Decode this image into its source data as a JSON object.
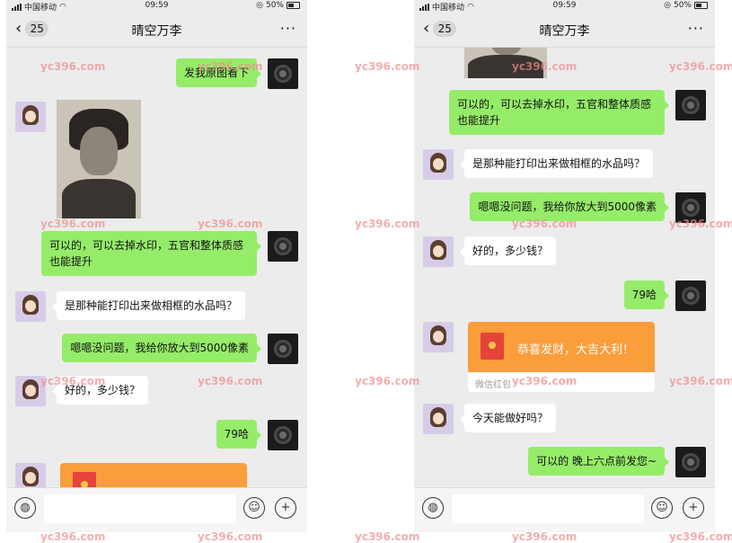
{
  "status": {
    "carrier": "中国移动",
    "time": "09:59",
    "battery": "50%"
  },
  "nav": {
    "back_count": "25",
    "title": "晴空万李",
    "more": "···"
  },
  "watermark": "yc396.com",
  "left_chat": {
    "msg1": "发我原图看下",
    "msg2": "可以的，可以去掉水印，五官和整体质感也能提升",
    "msg3": "是那种能打印出来做相框的水品吗？",
    "msg4": "嗯嗯没问题，我给你放大到5000像素",
    "msg5": "好的，多少钱？",
    "msg6": "79哈"
  },
  "right_chat": {
    "msg1": "可以的，可以去掉水印，五官和整体质感也能提升",
    "msg2": "是那种能打印出来做相框的水品吗？",
    "msg3": "嗯嗯没问题，我给你放大到5000像素",
    "msg4": "好的，多少钱？",
    "msg5": "79哈",
    "redpacket_text": "恭喜发财，大吉大利！",
    "redpacket_label": "微信红包",
    "msg6": "今天能做好吗？",
    "msg7": "可以的 晚上六点前发您~"
  },
  "icons": {
    "voice": "voice-icon",
    "emoji": "emoji-icon",
    "plus": "plus-icon",
    "back": "chevron-left-icon",
    "more": "more-icon"
  },
  "colors": {
    "green_bubble": "#95ec69",
    "redpacket": "#fa9d3b",
    "watermark": "#f08c8c"
  }
}
